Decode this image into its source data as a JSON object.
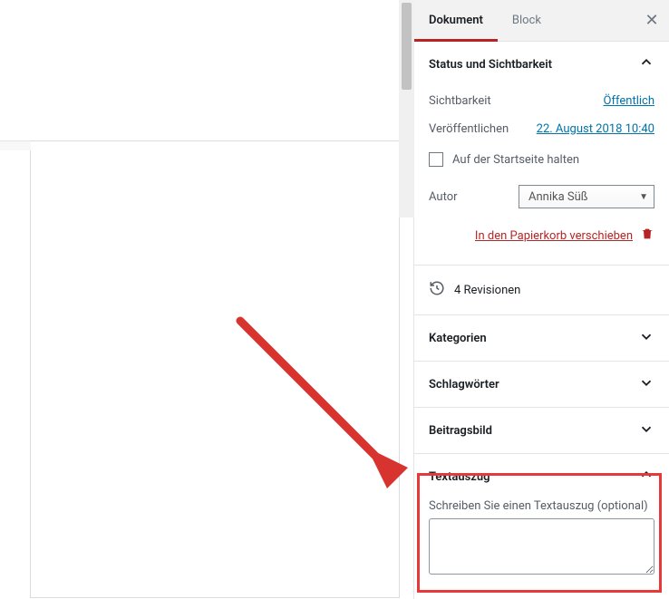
{
  "tabs": {
    "document": "Dokument",
    "block": "Block"
  },
  "panels": {
    "status": {
      "title": "Status und Sichtbarkeit",
      "visibility_label": "Sichtbarkeit",
      "visibility_value": "Öffentlich",
      "publish_label": "Veröffentlichen",
      "publish_value": "22. August 2018 10:40",
      "stick_label": "Auf der Startseite halten",
      "author_label": "Autor",
      "author_value": "Annika Süß",
      "trash_label": "In den Papierkorb verschieben"
    },
    "revisions": {
      "text": "4 Revisionen"
    },
    "categories": {
      "title": "Kategorien"
    },
    "tags": {
      "title": "Schlagwörter"
    },
    "featured": {
      "title": "Beitragsbild"
    },
    "excerpt": {
      "title": "Textauszug",
      "field_label": "Schreiben Sie einen Textauszug (optional)"
    }
  }
}
